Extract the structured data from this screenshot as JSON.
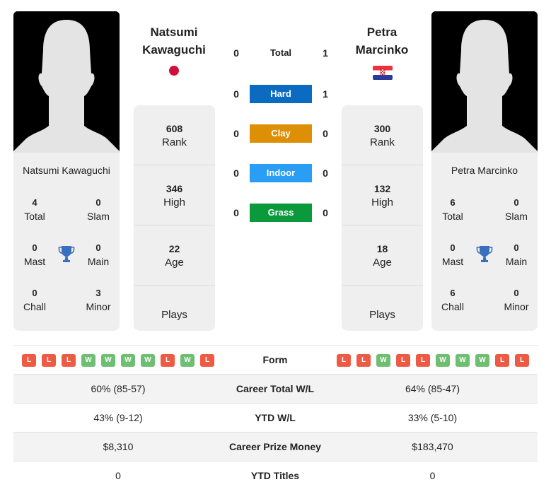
{
  "player1": {
    "name": "Natsumi Kawaguchi",
    "header_line1": "Natsumi",
    "header_line2": "Kawaguchi",
    "flag": "japan-flag",
    "titles": {
      "total": {
        "value": "4",
        "label": "Total"
      },
      "slam": {
        "value": "0",
        "label": "Slam"
      },
      "mast": {
        "value": "0",
        "label": "Mast"
      },
      "main": {
        "value": "0",
        "label": "Main"
      },
      "chall": {
        "value": "0",
        "label": "Chall"
      },
      "minor": {
        "value": "3",
        "label": "Minor"
      }
    },
    "rank": {
      "value": "608",
      "label": "Rank"
    },
    "high": {
      "value": "346",
      "label": "High"
    },
    "age": {
      "value": "22",
      "label": "Age"
    },
    "plays": {
      "value": "",
      "label": "Plays"
    },
    "form": [
      "L",
      "L",
      "L",
      "W",
      "W",
      "W",
      "W",
      "L",
      "W",
      "L"
    ]
  },
  "player2": {
    "name": "Petra Marcinko",
    "header_line1": "Petra",
    "header_line2": "Marcinko",
    "flag": "croatia-flag",
    "titles": {
      "total": {
        "value": "6",
        "label": "Total"
      },
      "slam": {
        "value": "0",
        "label": "Slam"
      },
      "mast": {
        "value": "0",
        "label": "Mast"
      },
      "main": {
        "value": "0",
        "label": "Main"
      },
      "chall": {
        "value": "6",
        "label": "Chall"
      },
      "minor": {
        "value": "0",
        "label": "Minor"
      }
    },
    "rank": {
      "value": "300",
      "label": "Rank"
    },
    "high": {
      "value": "132",
      "label": "High"
    },
    "age": {
      "value": "18",
      "label": "Age"
    },
    "plays": {
      "value": "",
      "label": "Plays"
    },
    "form": [
      "L",
      "L",
      "W",
      "L",
      "L",
      "W",
      "W",
      "W",
      "L",
      "L"
    ]
  },
  "h2h": [
    {
      "label": "Total",
      "p1": "0",
      "p2": "1",
      "color": ""
    },
    {
      "label": "Hard",
      "p1": "0",
      "p2": "1",
      "color": "#0a6bc1"
    },
    {
      "label": "Clay",
      "p1": "0",
      "p2": "0",
      "color": "#dd8f05"
    },
    {
      "label": "Indoor",
      "p1": "0",
      "p2": "0",
      "color": "#2a9df4"
    },
    {
      "label": "Grass",
      "p1": "0",
      "p2": "0",
      "color": "#0a9a3c"
    }
  ],
  "comparison": {
    "form_label": "Form",
    "rows": [
      {
        "label": "Career Total W/L",
        "p1": "60% (85-57)",
        "p2": "64% (85-47)"
      },
      {
        "label": "YTD W/L",
        "p1": "43% (9-12)",
        "p2": "33% (5-10)"
      },
      {
        "label": "Career Prize Money",
        "p1": "$8,310",
        "p2": "$183,470"
      },
      {
        "label": "YTD Titles",
        "p1": "0",
        "p2": "0"
      }
    ]
  },
  "colors": {
    "win": "#6fbf73",
    "loss": "#ee5b44",
    "trophy": "#3a6fbf"
  }
}
